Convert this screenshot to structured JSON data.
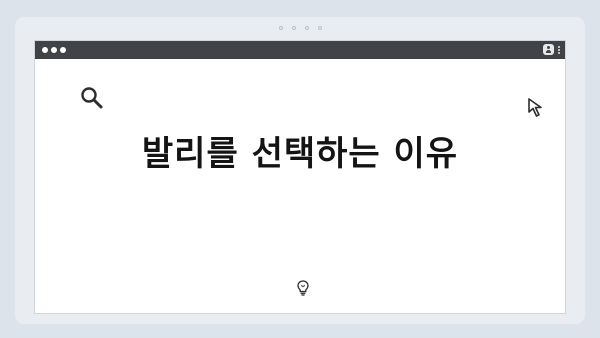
{
  "hero": {
    "title": "발리를 선택하는 이유"
  },
  "icons": {
    "search": "search-icon",
    "cursor": "cursor-icon",
    "lightbulb": "lightbulb-icon",
    "user": "user-icon",
    "menu": "kebab-menu-icon"
  },
  "colors": {
    "titlebar": "#414347",
    "background": "#dde3ea",
    "window": "#ffffff",
    "text": "#141414"
  }
}
